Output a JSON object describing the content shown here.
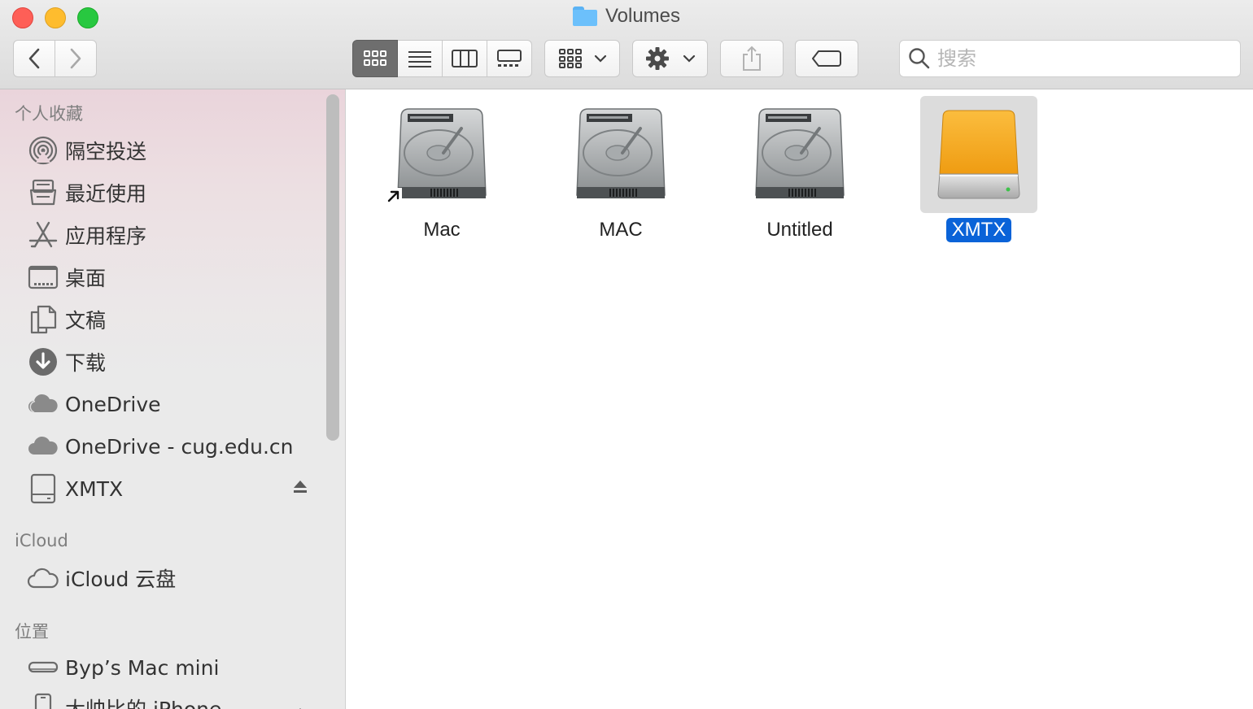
{
  "window": {
    "title": "Volumes"
  },
  "toolbar": {
    "search_placeholder": "搜索",
    "view_modes": [
      "icon-view",
      "list-view",
      "column-view",
      "gallery-view"
    ],
    "active_view": "icon-view"
  },
  "sidebar": {
    "favorites_title": "个人收藏",
    "favorites": [
      {
        "label": "隔空投送",
        "icon": "airdrop-icon"
      },
      {
        "label": "最近使用",
        "icon": "recents-icon"
      },
      {
        "label": "应用程序",
        "icon": "applications-icon"
      },
      {
        "label": "桌面",
        "icon": "desktop-icon"
      },
      {
        "label": "文稿",
        "icon": "documents-icon"
      },
      {
        "label": "下载",
        "icon": "downloads-icon"
      },
      {
        "label": "OneDrive",
        "icon": "cloud-icon"
      },
      {
        "label": "OneDrive - cug.edu.cn",
        "icon": "cloud-icon"
      },
      {
        "label": "XMTX",
        "icon": "external-drive-icon"
      }
    ],
    "icloud_title": "iCloud",
    "icloud": [
      {
        "label": "iCloud 云盘",
        "icon": "icloud-icon"
      }
    ],
    "locations_title": "位置",
    "locations": [
      {
        "label": "Byp’s Mac mini",
        "icon": "mac-mini-icon"
      },
      {
        "label": "大帅比的 iPhone",
        "icon": "iphone-icon"
      }
    ]
  },
  "volumes": [
    {
      "name": "Mac",
      "icon": "hard-disk-icon",
      "alias": true,
      "selected": false
    },
    {
      "name": "MAC",
      "icon": "hard-disk-icon",
      "alias": false,
      "selected": false
    },
    {
      "name": "Untitled",
      "icon": "hard-disk-icon",
      "alias": false,
      "selected": false
    },
    {
      "name": "XMTX",
      "icon": "external-drive-icon",
      "alias": false,
      "selected": true
    }
  ],
  "colors": {
    "selection": "#0a63d8",
    "sidebar_tint": "#ead4db",
    "external_drive": "#f5a623"
  }
}
